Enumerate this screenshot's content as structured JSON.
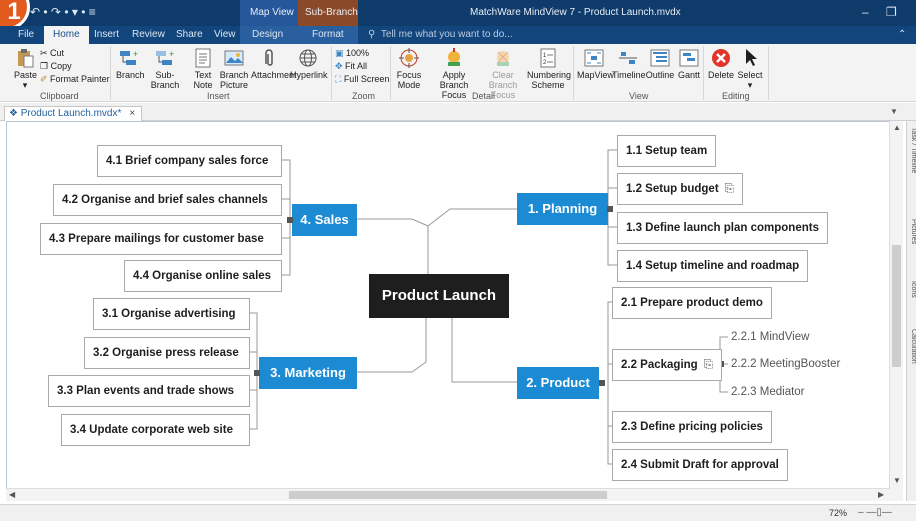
{
  "titlebar": {
    "app_logo": "1",
    "quick_access": "↶ • ↷ • ▾ • ≡",
    "context_group_a": "Map View",
    "context_group_b": "Sub-Branch",
    "title": "MatchWare MindView 7 - Product Launch.mvdx",
    "minimize": "–",
    "maximize": "❐",
    "colors": {
      "bar": "#0f3b6b",
      "context_b": "#8a4a2a",
      "logo": "#e35a1e"
    }
  },
  "tabs": {
    "file": "File",
    "home": "Home",
    "insert": "Insert",
    "review": "Review",
    "share": "Share",
    "view": "View",
    "design": "Design",
    "format": "Format",
    "tell_me": "Tell me what you want to do..."
  },
  "ribbon": {
    "clipboard": {
      "paste": "Paste",
      "cut": "Cut",
      "copy": "Copy",
      "format_painter": "Format Painter",
      "group": "Clipboard"
    },
    "insert": {
      "branch": "Branch",
      "sub_branch": "Sub-Branch",
      "text_note": "Text Note",
      "branch_picture": "Branch Picture",
      "attachment": "Attachment",
      "hyperlink": "Hyperlink",
      "group": "Insert"
    },
    "zoom": {
      "hundred": "100%",
      "fit_all": "Fit All",
      "full_screen": "Full Screen",
      "group": "Zoom"
    },
    "detail": {
      "focus_mode": "Focus Mode",
      "apply_branch_focus": "Apply Branch Focus",
      "clear_branch_focus": "Clear Branch Focus",
      "numbering_scheme": "Numbering Scheme",
      "group": "Detail"
    },
    "view": {
      "mapview": "MapView",
      "timeline": "Timeline",
      "outline": "Outline",
      "gantt": "Gantt",
      "group": "View"
    },
    "editing": {
      "delete": "Delete",
      "select": "Select",
      "group": "Editing"
    }
  },
  "document_tab": {
    "label": "Product Launch.mvdx*",
    "close": "×"
  },
  "side_tabs": [
    "Task / Timeline",
    "Pictures",
    "Icons",
    "Calculation"
  ],
  "map": {
    "central": "Product Launch",
    "planning": {
      "label": "1. Planning",
      "children": [
        "1.1  Setup team",
        "1.2  Setup budget",
        "1.3  Define launch plan components",
        "1.4  Setup timeline and roadmap"
      ]
    },
    "product": {
      "label": "2. Product",
      "children": [
        "2.1  Prepare product demo",
        "2.2  Packaging",
        "2.3  Define pricing policies",
        "2.4  Submit Draft for approval"
      ],
      "packaging_children": [
        "2.2.1  MindView",
        "2.2.2  MeetingBooster",
        "2.2.3  Mediator"
      ]
    },
    "marketing": {
      "label": "3. Marketing",
      "children": [
        "3.1  Organise advertising",
        "3.2  Organise press release",
        "3.3  Plan events and trade shows",
        "3.4  Update corporate web site"
      ]
    },
    "sales": {
      "label": "4. Sales",
      "children": [
        "4.1  Brief company sales force",
        "4.2  Organise and brief sales channels",
        "4.3  Prepare mailings for customer base",
        "4.4  Organise online sales"
      ]
    },
    "colors": {
      "central": "#1e1e1e",
      "main": "#1d8bd4",
      "connector": "#9a9a9a"
    }
  },
  "attachment_icon": "⎘",
  "status": {
    "zoom": "72%"
  }
}
